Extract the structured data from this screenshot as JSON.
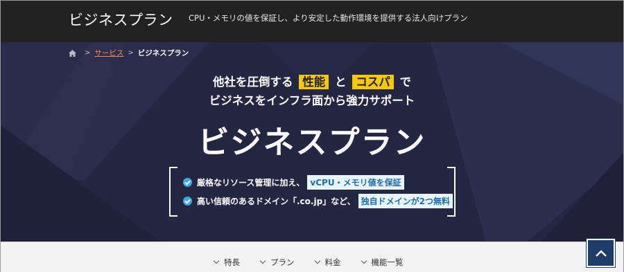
{
  "header": {
    "site_title": "ビジネスプラン",
    "tagline": "CPU・メモリの値を保証し、より安定した動作環境を提供する法人向けプラン"
  },
  "breadcrumb": {
    "home_icon": "home-icon",
    "parent": "サービス",
    "current": "ビジネスプラン"
  },
  "hero": {
    "lead1_pre": "他社を圧倒する",
    "lead1_hl1": "性能",
    "lead1_mid": "と",
    "lead1_hl2": "コスパ",
    "lead1_post": "で",
    "lead2": "ビジネスをインフラ面から強力サポート",
    "title": "ビジネスプラン",
    "features": [
      {
        "text": "厳格なリソース管理に加え、",
        "highlight": "vCPU・メモリ値を保証"
      },
      {
        "text": "高い信頼のあるドメイン「.co.jp」など、",
        "highlight": "独自ドメインが2つ無料"
      }
    ],
    "colors": {
      "background": "#242742",
      "highlight_yellow": "#f7c900",
      "check_blue": "#39a9e8"
    }
  },
  "page_nav": {
    "items": [
      "特長",
      "プラン",
      "料金",
      "機能一覧"
    ]
  },
  "to_top": {
    "icon": "chevron-up-icon"
  }
}
